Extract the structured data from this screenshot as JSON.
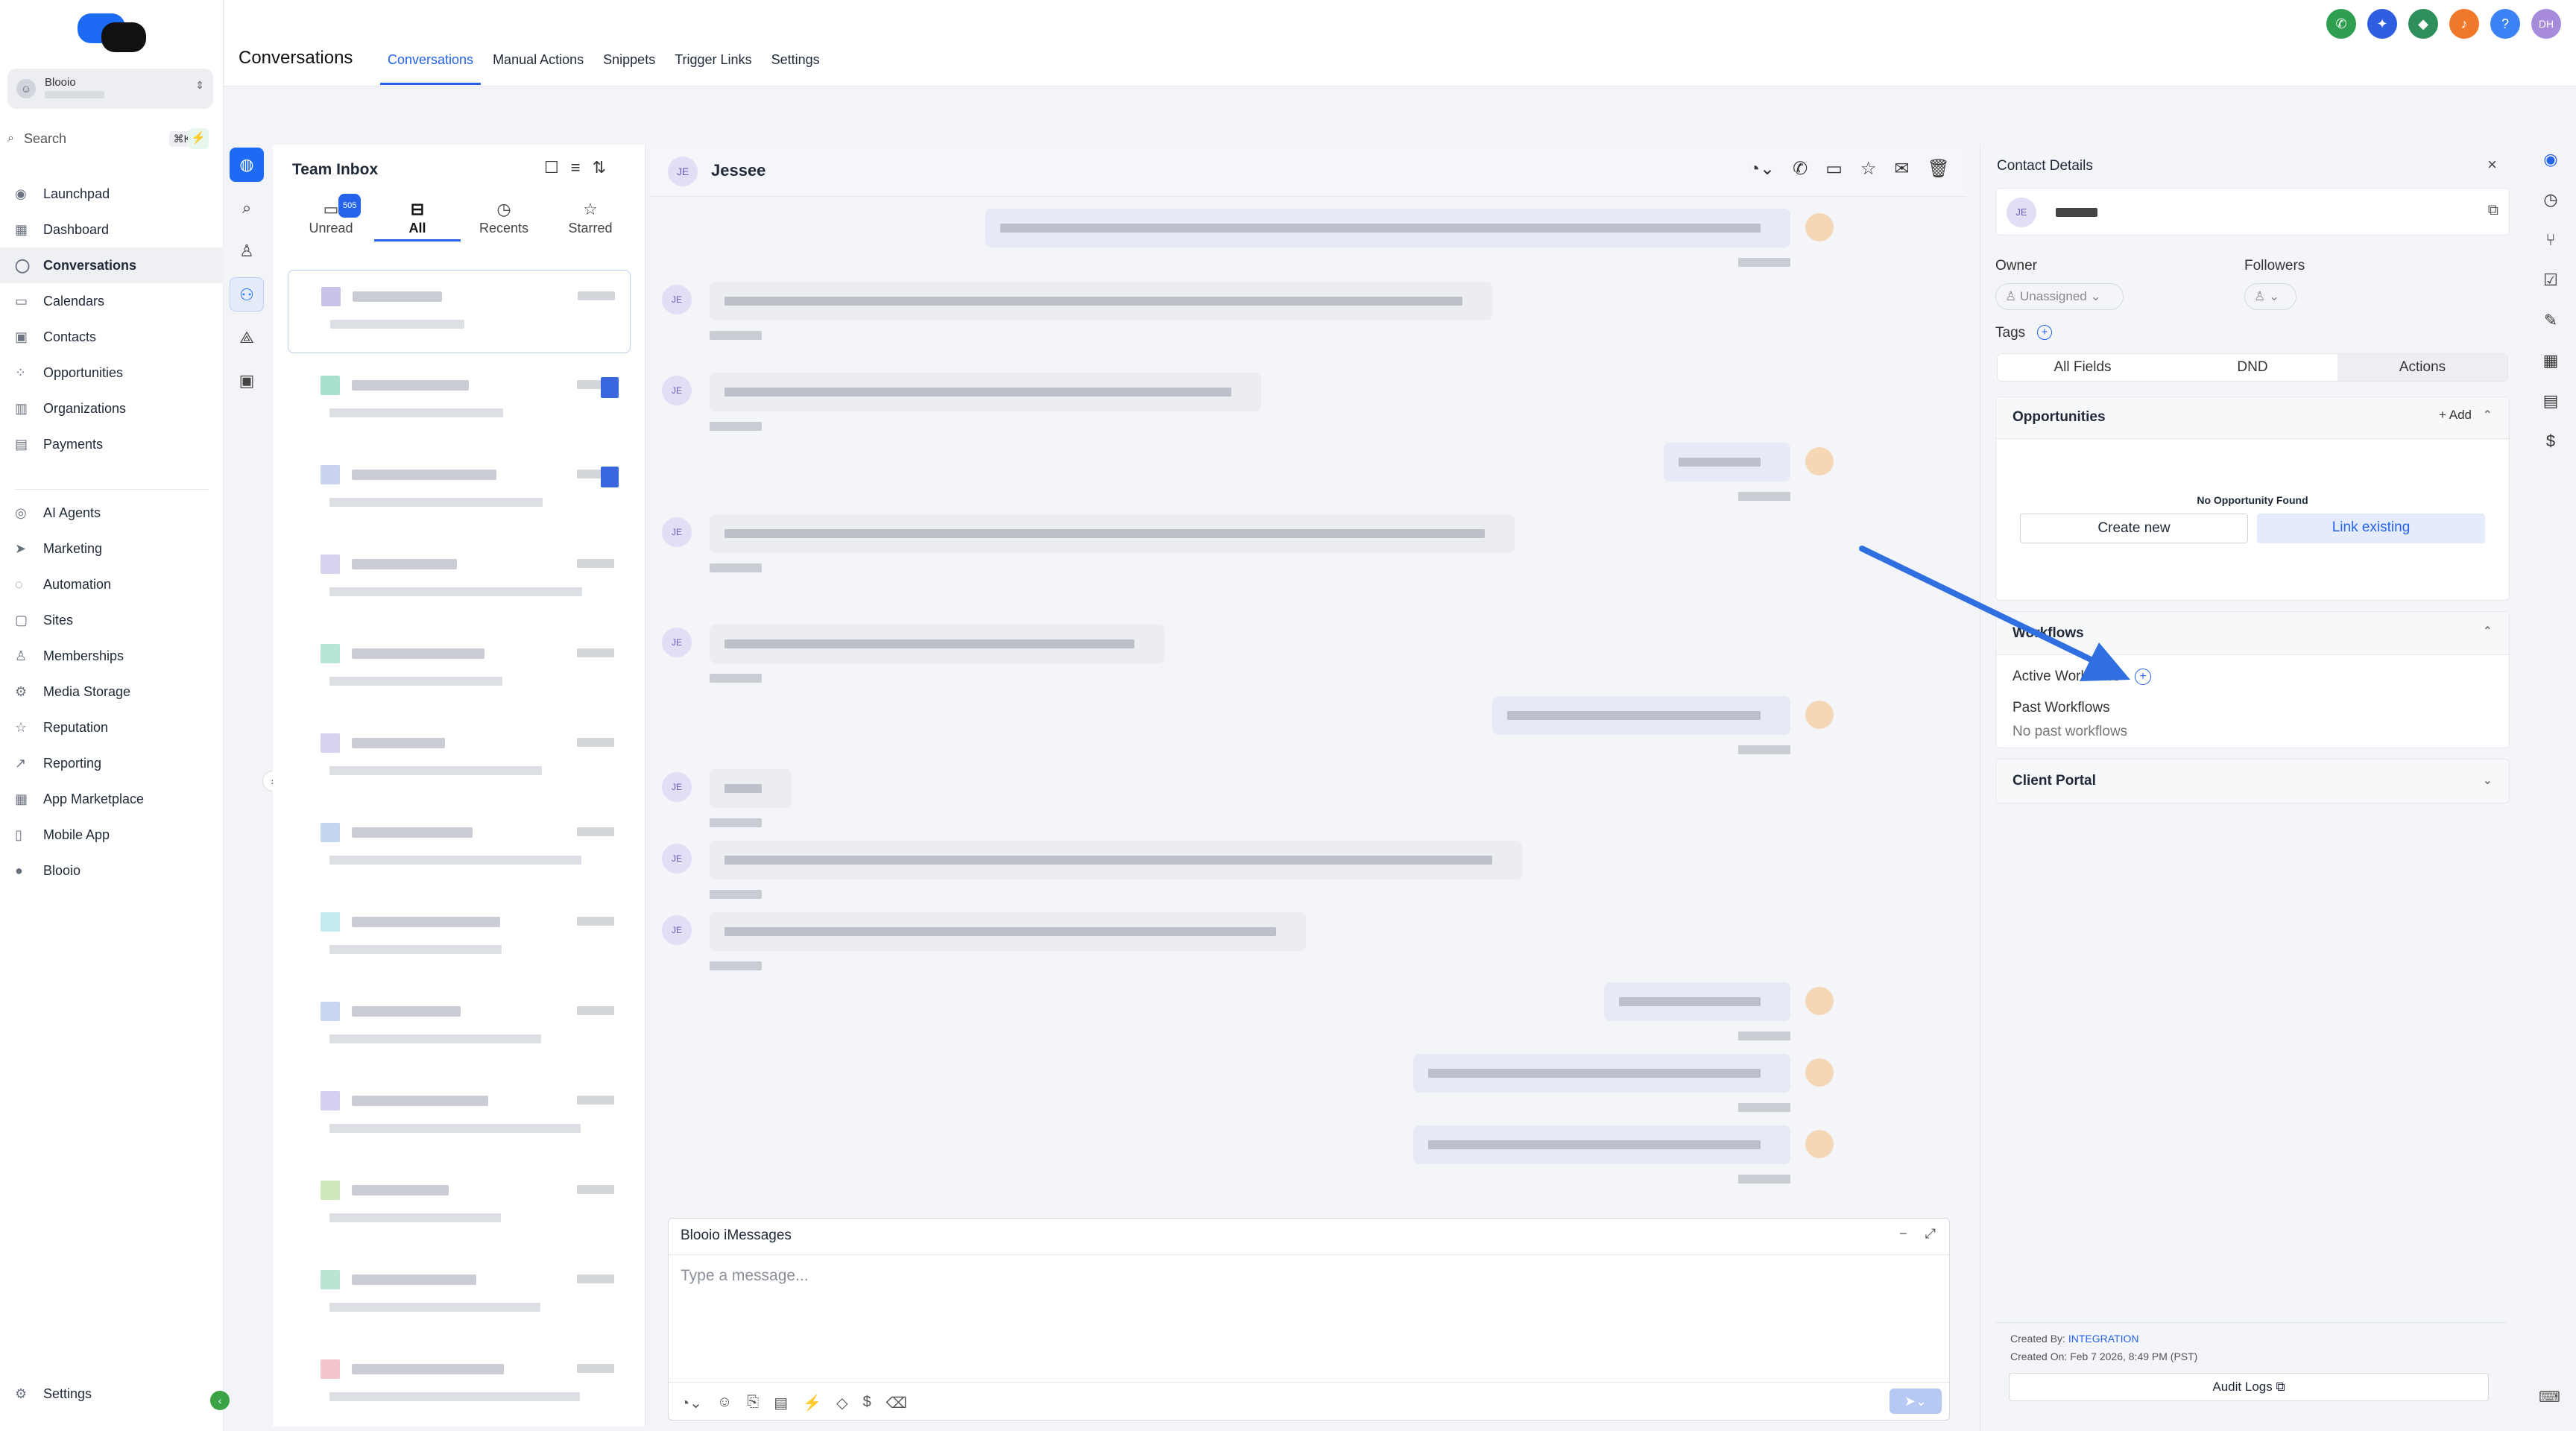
{
  "sidebar": {
    "account_name": "Blooio",
    "search_placeholder": "Search",
    "search_shortcut": "⌘K",
    "nav": [
      {
        "label": "Launchpad",
        "icon": "rocket-icon",
        "glyph": "◉"
      },
      {
        "label": "Dashboard",
        "icon": "dashboard-icon",
        "glyph": "▦"
      },
      {
        "label": "Conversations",
        "icon": "chat-icon",
        "glyph": "◯",
        "active": true
      },
      {
        "label": "Calendars",
        "icon": "calendar-icon",
        "glyph": "▭"
      },
      {
        "label": "Contacts",
        "icon": "contacts-icon",
        "glyph": "▣"
      },
      {
        "label": "Opportunities",
        "icon": "opportunities-icon",
        "glyph": "⁘"
      },
      {
        "label": "Organizations",
        "icon": "organizations-icon",
        "glyph": "▥"
      },
      {
        "label": "Payments",
        "icon": "payments-icon",
        "glyph": "▤"
      }
    ],
    "nav2": [
      {
        "label": "AI Agents",
        "icon": "ai-agents-icon",
        "glyph": "◎"
      },
      {
        "label": "Marketing",
        "icon": "marketing-icon",
        "glyph": "➤"
      },
      {
        "label": "Automation",
        "icon": "automation-icon",
        "glyph": "◌"
      },
      {
        "label": "Sites",
        "icon": "sites-icon",
        "glyph": "▢"
      },
      {
        "label": "Memberships",
        "icon": "memberships-icon",
        "glyph": "♙"
      },
      {
        "label": "Media Storage",
        "icon": "media-storage-icon",
        "glyph": "⚙"
      },
      {
        "label": "Reputation",
        "icon": "reputation-icon",
        "glyph": "☆"
      },
      {
        "label": "Reporting",
        "icon": "reporting-icon",
        "glyph": "↗"
      },
      {
        "label": "App Marketplace",
        "icon": "marketplace-icon",
        "glyph": "▦"
      },
      {
        "label": "Mobile App",
        "icon": "mobile-icon",
        "glyph": "▯"
      },
      {
        "label": "Blooio",
        "icon": "blooio-icon",
        "glyph": "●"
      }
    ],
    "settings_label": "Settings"
  },
  "header": {
    "title": "Conversations",
    "tabs": [
      "Conversations",
      "Manual Actions",
      "Snippets",
      "Trigger Links",
      "Settings"
    ],
    "avatar_initials": "DH"
  },
  "inbox": {
    "title": "Team Inbox",
    "tabs": [
      {
        "label": "Unread",
        "icon": "unread-icon",
        "glyph": "▭"
      },
      {
        "label": "All",
        "icon": "inbox-icon",
        "glyph": "⊟"
      },
      {
        "label": "Recents",
        "icon": "recents-icon",
        "glyph": "◷"
      },
      {
        "label": "Starred",
        "icon": "star-icon",
        "glyph": "☆"
      }
    ],
    "unread_count": "505"
  },
  "chat": {
    "contact_name": "Jessee",
    "contact_initials": "JE",
    "composer_label": "Blooio iMessages",
    "composer_placeholder": "Type a message..."
  },
  "contact_panel": {
    "title": "Contact Details",
    "initials": "JE",
    "owner_label": "Owner",
    "owner_value": "Unassigned",
    "followers_label": "Followers",
    "tags_label": "Tags",
    "tabs": [
      "All Fields",
      "DND",
      "Actions"
    ],
    "opportunities_title": "Opportunities",
    "add_label": "Add",
    "no_opportunity": "No Opportunity Found",
    "create_new": "Create new",
    "link_existing": "Link existing",
    "workflows_title": "Workflows",
    "active_workflows": "Active Workflows",
    "past_workflows": "Past Workflows",
    "no_past_workflows": "No past workflows",
    "client_portal": "Client Portal",
    "created_by_label": "Created By:",
    "created_by_value": "INTEGRATION",
    "created_on": "Created On: Feb 7 2026, 8:49 PM (PST)",
    "audit_logs": "Audit Logs"
  },
  "colors": {
    "accent": "#2563eb",
    "arrow": "#2f6fe0"
  }
}
